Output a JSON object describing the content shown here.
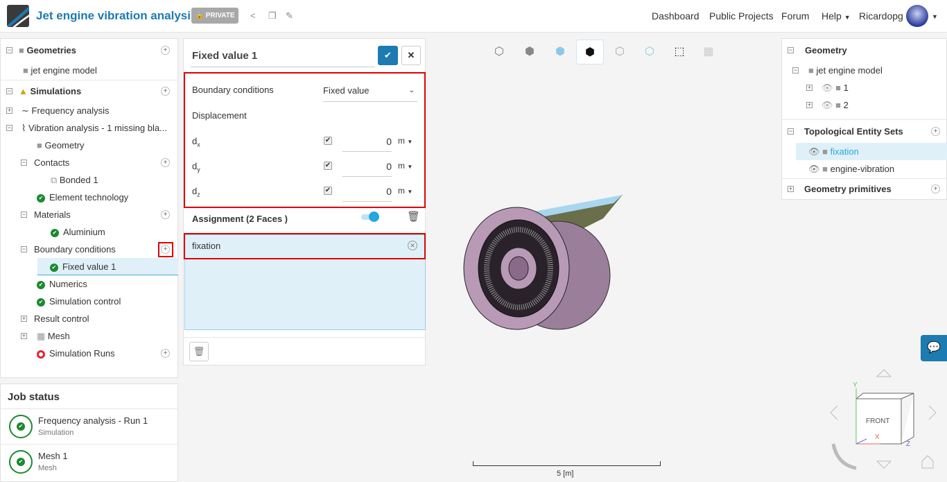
{
  "header": {
    "title": "Jet engine vibration analysis",
    "private_label": "PRIVATE",
    "nav": [
      "Dashboard",
      "Public Projects",
      "Forum",
      "Help"
    ],
    "user": "Ricardopg"
  },
  "tree": {
    "geometries": "Geometries",
    "geometry_item": "jet engine model",
    "simulations": "Simulations",
    "items": [
      {
        "label": "Frequency analysis",
        "level": 0
      },
      {
        "label": "Vibration analysis - 1 missing bla...",
        "level": 0
      },
      {
        "label": "Geometry",
        "level": 1
      },
      {
        "label": "Contacts",
        "level": 1
      },
      {
        "label": "Bonded 1",
        "level": 2
      },
      {
        "label": "Element technology",
        "level": 1
      },
      {
        "label": "Materials",
        "level": 1
      },
      {
        "label": "Aluminium",
        "level": 2
      },
      {
        "label": "Boundary conditions",
        "level": 1
      },
      {
        "label": "Fixed value 1",
        "level": 2
      },
      {
        "label": "Numerics",
        "level": 1
      },
      {
        "label": "Simulation control",
        "level": 1
      },
      {
        "label": "Result control",
        "level": 1
      },
      {
        "label": "Mesh",
        "level": 1
      },
      {
        "label": "Simulation Runs",
        "level": 1
      }
    ]
  },
  "job_status": {
    "title": "Job status",
    "jobs": [
      {
        "name": "Frequency analysis - Run 1",
        "type": "Simulation",
        "status": "finished"
      },
      {
        "name": "Mesh 1",
        "type": "Mesh",
        "status": "finished"
      }
    ]
  },
  "dialog": {
    "name": "Fixed value 1",
    "bc_label": "Boundary conditions",
    "bc_value": "Fixed value",
    "displacement": "Displacement",
    "components": [
      {
        "label": "d",
        "sub": "x",
        "checked": true,
        "value": "0",
        "unit": "m"
      },
      {
        "label": "d",
        "sub": "y",
        "checked": true,
        "value": "0",
        "unit": "m"
      },
      {
        "label": "d",
        "sub": "z",
        "checked": true,
        "value": "0",
        "unit": "m"
      }
    ],
    "assignment": "Assignment (2 Faces )",
    "assignment_toggle": true,
    "assigned": "fixation"
  },
  "right": {
    "geometry": "Geometry",
    "model": "jet engine model",
    "parts": [
      "1",
      "2"
    ],
    "topo": "Topological Entity Sets",
    "sets": [
      "fixation",
      "engine-vibration"
    ],
    "primitives": "Geometry primitives"
  },
  "viewport": {
    "scale_label": "5 [m]",
    "cube_face": "FRONT",
    "axis_y": "Y",
    "axis_x": "X",
    "axis_z": "Z"
  },
  "colors": {
    "accent": "#1c7bb0",
    "ok": "#1a8a2e",
    "highlight": "#e00000"
  }
}
